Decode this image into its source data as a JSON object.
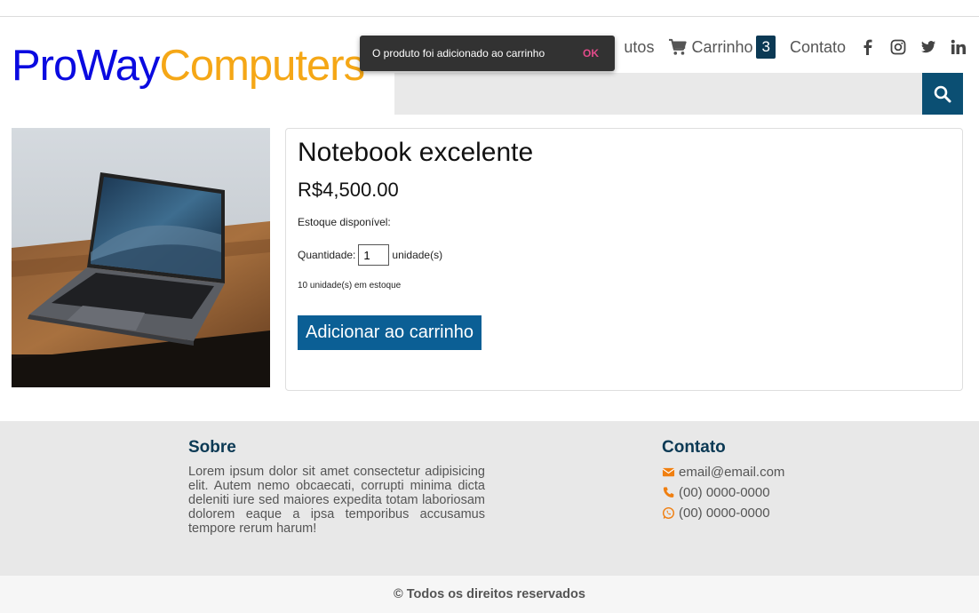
{
  "logo": {
    "part1": "ProWay",
    "part2": "Computers"
  },
  "nav": {
    "produtos_label": "utos",
    "cart_label": "Carrinho",
    "cart_count": "3",
    "contato_label": "Contato",
    "social_icons": [
      "facebook-icon",
      "instagram-icon",
      "twitter-icon",
      "linkedin-icon"
    ]
  },
  "search": {
    "placeholder": ""
  },
  "toast": {
    "message": "O produto foi adicionado ao carrinho",
    "action": "OK"
  },
  "product": {
    "title": "Notebook excelente",
    "price": "R$4,500.00",
    "stock_label": "Estoque disponível:",
    "quantity_label": "Quantidade:",
    "quantity_value": "1",
    "unit_label": "unidade(s)",
    "stock_count": "10 unidade(s) em estoque",
    "add_button": "Adicionar ao carrinho"
  },
  "footer": {
    "about_title": "Sobre",
    "about_text": "Lorem ipsum dolor sit amet consectetur adipisicing elit. Autem nemo obcaecati, corrupti minima dicta deleniti iure sed maiores expedita totam laboriosam dolorem eaque a ipsa temporibus accusamus tempore rerum harum!",
    "contact_title": "Contato",
    "email": "email@email.com",
    "phone": "(00) 0000-0000",
    "whatsapp": "(00) 0000-0000",
    "copyright": "© Todos os direitos reservados"
  },
  "colors": {
    "brand_blue": "#0a0ae0",
    "brand_orange": "#f5a716",
    "primary_dark": "#0b3954",
    "button_blue": "#0b5f95",
    "icon_orange": "#f07f10"
  }
}
